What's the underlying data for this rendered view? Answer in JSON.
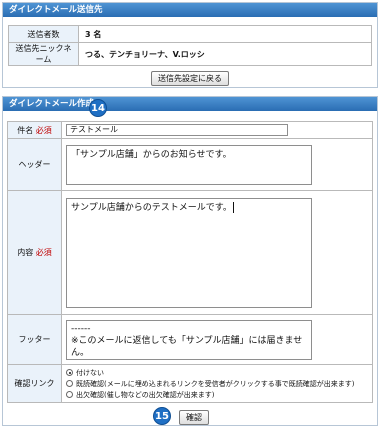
{
  "recipient": {
    "header": "ダイレクトメール送信先",
    "rows": [
      {
        "label": "送信者数",
        "value": "3 名"
      },
      {
        "label": "送信先ニックネーム",
        "value": "つる、テンチョリーナ、V.ロッシ"
      }
    ],
    "back_button": "送信先設定に戻る"
  },
  "compose": {
    "header": "ダイレクトメール作成",
    "badge_top": "14",
    "subject": {
      "label": "件名",
      "required": "必須",
      "value": "テストメール"
    },
    "header_field": {
      "label": "ヘッダー",
      "value": "「サンプル店舗」からのお知らせです。"
    },
    "body": {
      "label": "内容",
      "required": "必須",
      "value": "サンプル店舗からのテストメールです。"
    },
    "footer_field": {
      "label": "フッター",
      "value": "------\n※このメールに返信しても「サンプル店舗」には届きません。"
    },
    "confirm": {
      "label": "確認リンク",
      "options": [
        {
          "label": "付けない",
          "selected": true
        },
        {
          "label": "既読確認(メールに埋め込まれるリンクを受信者がクリックする事で既読確認が出来ます)",
          "selected": false
        },
        {
          "label": "出欠確認(催し物などの出欠確認が出来ます)",
          "selected": false
        }
      ]
    },
    "badge_bottom": "15",
    "confirm_button": "確認"
  }
}
